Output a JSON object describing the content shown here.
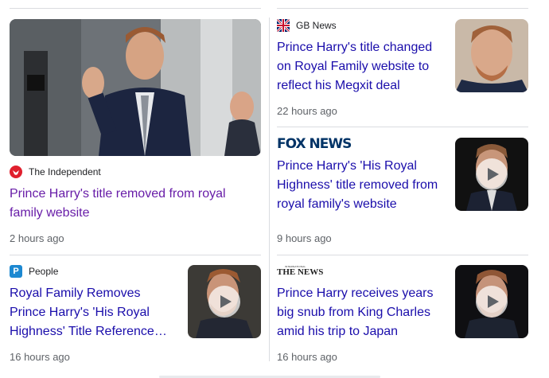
{
  "articles": [
    {
      "source": "The Independent",
      "headline_lines": [
        "Prince Harry's title removed from royal",
        "family website"
      ],
      "time": "2 hours ago",
      "visited": true,
      "colors": {
        "source_icon": "#e0202e"
      }
    },
    {
      "source": "GB News",
      "headline_lines": [
        "Prince Harry's title changed",
        "on Royal Family website to",
        "reflect his Megxit deal"
      ],
      "time": "22 hours ago",
      "colors": {
        "flag_blue": "#012169",
        "flag_red": "#c8102e"
      }
    },
    {
      "source": "FOX NEWS",
      "headline_lines": [
        "Prince Harry's 'His Royal",
        "Highness' title removed from",
        "royal family's website"
      ],
      "time": "9 hours ago",
      "video": true
    },
    {
      "source": "People",
      "headline_lines": [
        "Royal Family Removes",
        "Prince Harry's 'His Royal",
        "Highness' Title Reference…"
      ],
      "time": "16 hours ago",
      "video": true,
      "colors": {
        "source_icon": "#1c88d1"
      }
    },
    {
      "source": "THE NEWS",
      "source_sub": "INTERNATIONAL",
      "headline_lines": [
        "Prince Harry receives years",
        "big snub from King Charles",
        "amid his trip to Japan"
      ],
      "time": "16 hours ago",
      "video": true
    }
  ],
  "icons": [
    "independent-eagle-icon",
    "uk-flag-icon",
    "people-p-icon",
    "play-icon"
  ],
  "colors": {
    "link": "#1a0dab",
    "visited": "#681da8",
    "meta": "#5f6368",
    "divider": "#dadce0"
  }
}
